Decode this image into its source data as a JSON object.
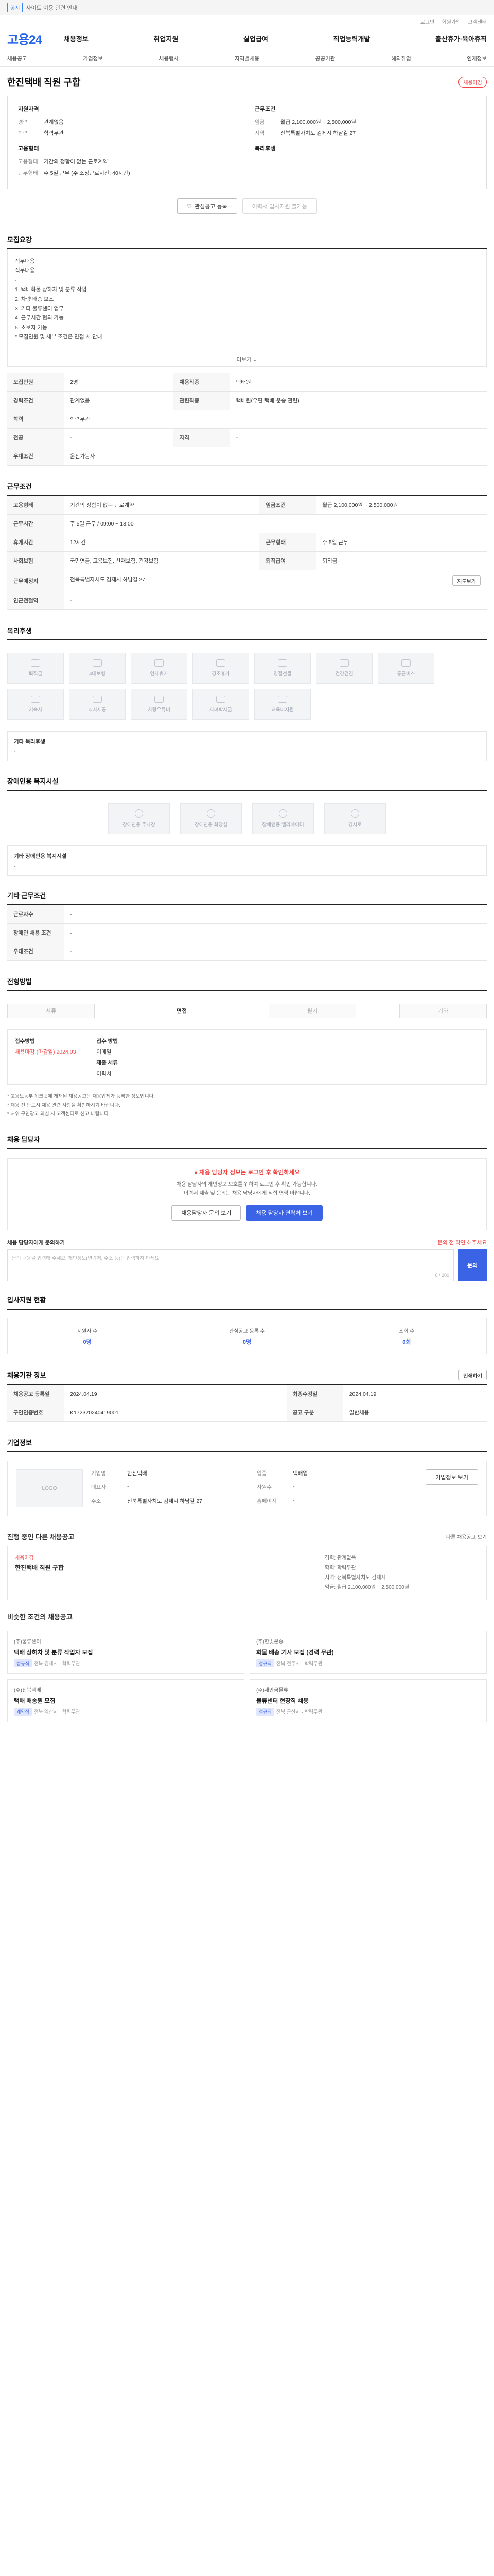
{
  "topbar": {
    "tag": "공지",
    "text": "사이트 이용 관련 안내"
  },
  "util": [
    "로그인",
    "회원가입",
    "고객센터"
  ],
  "logo": "고용24",
  "gnb": [
    "채용정보",
    "취업지원",
    "실업급여",
    "직업능력개발",
    "출산휴가·육아휴직"
  ],
  "lnb": [
    "채용공고",
    "기업정보",
    "채용행사",
    "지역별채용",
    "공공기관",
    "해외취업",
    "인재정보"
  ],
  "job": {
    "title": "한진택배 직원 구합",
    "badge": "채용마감",
    "left_title": "지원자격",
    "left": [
      {
        "k": "경력",
        "v": "관계없음"
      },
      {
        "k": "학력",
        "v": "학력무관"
      }
    ],
    "left2_title": "고용형태",
    "left2": [
      {
        "k": "고용형태",
        "v": "기간의 정함이 없는 근로계약"
      },
      {
        "k": "근무형태",
        "v": "주 5일 근무 (주 소정근로시간: 40시간)"
      }
    ],
    "right_title": "근무조건",
    "right": [
      {
        "k": "임금",
        "v": "월급 2,100,000원 ~ 2,500,000원"
      },
      {
        "k": "지역",
        "v": "전북특별자치도 김제시 하남길 27"
      }
    ],
    "right2_title": "복리후생",
    "btn_save": "관심공고 등록",
    "btn_apply": "이력서 입사지원 불가능"
  },
  "recruit": {
    "title": "모집요강",
    "desc": [
      "직무내용",
      "직무내용",
      "-",
      "1. 택배화물 상하차 및 분류 작업",
      "2. 차량 배송 보조",
      "3. 기타 물류센터 업무",
      "4. 근무시간 협의 가능",
      "5. 초보자 가능",
      "",
      "* 모집인원 및 세부 조건은 면접 시 안내"
    ],
    "more": "더보기",
    "rows": [
      {
        "h1": "모집인원",
        "v1": "2명",
        "h2": "채용직종",
        "v2": "택배원"
      },
      {
        "h1": "경력조건",
        "v1": "관계없음",
        "h2": "관련직종",
        "v2": "택배원(우편·택배·운송 관련)"
      },
      {
        "h1": "학력",
        "v1": "학력무관",
        "h2": "",
        "v2": ""
      },
      {
        "h1": "전공",
        "v1": "-",
        "h2": "자격",
        "v2": "-"
      },
      {
        "h1": "우대조건",
        "v1": "운전가능자",
        "h2": "",
        "v2": ""
      }
    ]
  },
  "condition": {
    "title": "근무조건",
    "rows": [
      {
        "h1": "고용형태",
        "v1": "기간의 정함이 없는 근로계약",
        "h2": "임금조건",
        "v2": "월급 2,100,000원 ~ 2,500,000원"
      },
      {
        "h1": "근무시간",
        "v1": "주 5일 근무 / 09:00 ~ 18:00",
        "h2": "",
        "v2": ""
      },
      {
        "h1": "휴게시간",
        "v1": "12시간",
        "h2": "근무형태",
        "v2": "주 5일 근무"
      },
      {
        "h1": "사회보험",
        "v1": "국민연금, 고용보험, 산재보험, 건강보험",
        "h2": "퇴직급여",
        "v2": "퇴직금"
      },
      {
        "h1": "근무예정지",
        "v1": "전북특별자치도 김제시 하남길 27",
        "h2": "",
        "v2": ""
      },
      {
        "h1": "인근전철역",
        "v1": "-",
        "h2": "",
        "v2": ""
      }
    ],
    "map_btn": "지도보기"
  },
  "welfare": {
    "title": "복리후생",
    "items": [
      "퇴직금",
      "4대보험",
      "연차휴가",
      "경조휴가",
      "명절선물",
      "건강검진",
      "통근버스",
      "기숙사",
      "식사제공",
      "차량유류비",
      "자녀학자금",
      "교육비지원"
    ],
    "sub_label": "기타 복리후생",
    "sub_value": "-"
  },
  "disability": {
    "title": "장애인용 복지시설",
    "items": [
      "장애인용 주차장",
      "장애인용 화장실",
      "장애인용 엘리베이터",
      "경사로"
    ],
    "sub_label": "기타 장애인용 복지시설",
    "sub_value": "-"
  },
  "worktype": {
    "title": "기타 근무조건",
    "rows": [
      {
        "h": "근로자수",
        "v": "-"
      },
      {
        "h": "장애인 채용 조건",
        "v": "-"
      },
      {
        "h": "우대조건",
        "v": "-"
      }
    ]
  },
  "process": {
    "title": "전형방법",
    "steps": [
      "서류",
      "면접",
      "필기",
      "기타"
    ],
    "active": 1,
    "apply_title": "접수방법",
    "apply": "채용마감 (마감일) 2024.03",
    "method_title": "접수 방법",
    "method": "이메일",
    "docs_title": "제출 서류",
    "docs": "이력서",
    "notes": [
      "* 고용노동부 워크넷에 게재된 채용공고는 채용업체가 등록한 정보입니다.",
      "* 채용 전 반드시 채용 관련 사항을 확인하시기 바랍니다.",
      "* 허위 구인광고 의심 시 고객센터로 신고 바랍니다."
    ]
  },
  "contact": {
    "title": "채용 담당자",
    "alert": "채용 담당자 정보는 로그인 후 확인하세요",
    "p1": "채용 담당자의 개인정보 보호를 위하여 로그인 후 확인 가능합니다.",
    "p2": "이력서 제출 및 문의는 채용 담당자에게 직접 연락 바랍니다.",
    "btn_a": "채용담당자 문의 보기",
    "btn_b": "채용 담당자 연락처 보기"
  },
  "inquiry": {
    "title": "채용 담당자에게 문의하기",
    "right": "문의 전 확인 해주세요",
    "placeholder": "문의 내용을 입력해 주세요. 개인정보(연락처, 주소 등)는 입력하지 마세요.",
    "count": "0 / 200",
    "btn": "문의"
  },
  "status": {
    "title": "입사지원 현황",
    "cells": [
      {
        "l": "지원자 수",
        "n": "0명"
      },
      {
        "l": "관심공고 등록 수",
        "n": "0명"
      },
      {
        "l": "조회 수",
        "n": "0회"
      }
    ]
  },
  "meta": {
    "title": "채용기관 정보",
    "rows": [
      {
        "h1": "채용공고 등록일",
        "v1": "2024.04.19",
        "h2": "최종수정일",
        "v2": "2024.04.19"
      },
      {
        "h1": "구인인증번호",
        "v1": "K172320240419001",
        "h2": "공고 구분",
        "v2": "일반채용"
      }
    ],
    "btn": "인쇄하기"
  },
  "company": {
    "title": "기업정보",
    "logo": "LOGO",
    "rows": [
      {
        "k": "기업명",
        "v": "한진택배"
      },
      {
        "k": "업종",
        "v": "택배업"
      },
      {
        "k": "대표자",
        "v": "-"
      },
      {
        "k": "사원수",
        "v": "-"
      },
      {
        "k": "주소",
        "v": "전북특별자치도 김제시 하남길 27"
      },
      {
        "k": "홈페이지",
        "v": "-"
      }
    ],
    "btn": "기업정보 보기"
  },
  "related": {
    "title": "진행 중인 다른 채용공고",
    "link": "다른 채용공고 보기",
    "org": "채용마감",
    "tt": "한진택배 직원 구합",
    "info": [
      "경력: 관계없음",
      "학력: 학력무관",
      "지역: 전북특별자치도 김제시",
      "임금: 월급 2,100,000원 ~ 2,500,000원"
    ]
  },
  "similar": {
    "title": "비슷한 조건의 채용공고",
    "cards": [
      {
        "co": "(주)물류센터",
        "ti": "택배 상하차 및 분류 작업자 모집",
        "pill": "정규직",
        "me": "전북 김제시 · 학력무관"
      },
      {
        "co": "(주)한빛운송",
        "ti": "화물 배송 기사 모집 (경력 무관)",
        "pill": "정규직",
        "me": "전북 전주시 · 학력무관"
      },
      {
        "co": "(주)전북택배",
        "ti": "택배 배송원 모집",
        "pill": "계약직",
        "me": "전북 익산시 · 학력무관"
      },
      {
        "co": "(주)새만금물류",
        "ti": "물류센터 현장직 채용",
        "pill": "정규직",
        "me": "전북 군산시 · 학력무관"
      }
    ]
  }
}
